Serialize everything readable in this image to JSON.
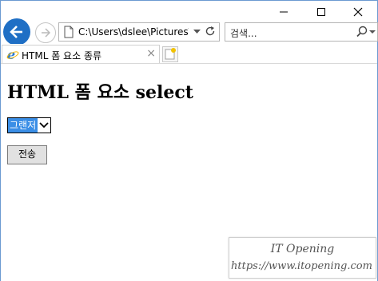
{
  "browser": {
    "address": "C:\\Users\\dslee\\Pictures\\",
    "search_placeholder": "검색...",
    "tab_title": "HTML 폼 요소 종류",
    "tab_close": "×"
  },
  "page": {
    "heading": "HTML 폼 요소 select",
    "select_value": "그랜저",
    "submit_label": "전송"
  },
  "watermark": {
    "title": "IT Opening",
    "url": "https://www.itopening.com"
  },
  "colors": {
    "accent": "#1f6fc5",
    "selection": "#3a8ee6"
  }
}
